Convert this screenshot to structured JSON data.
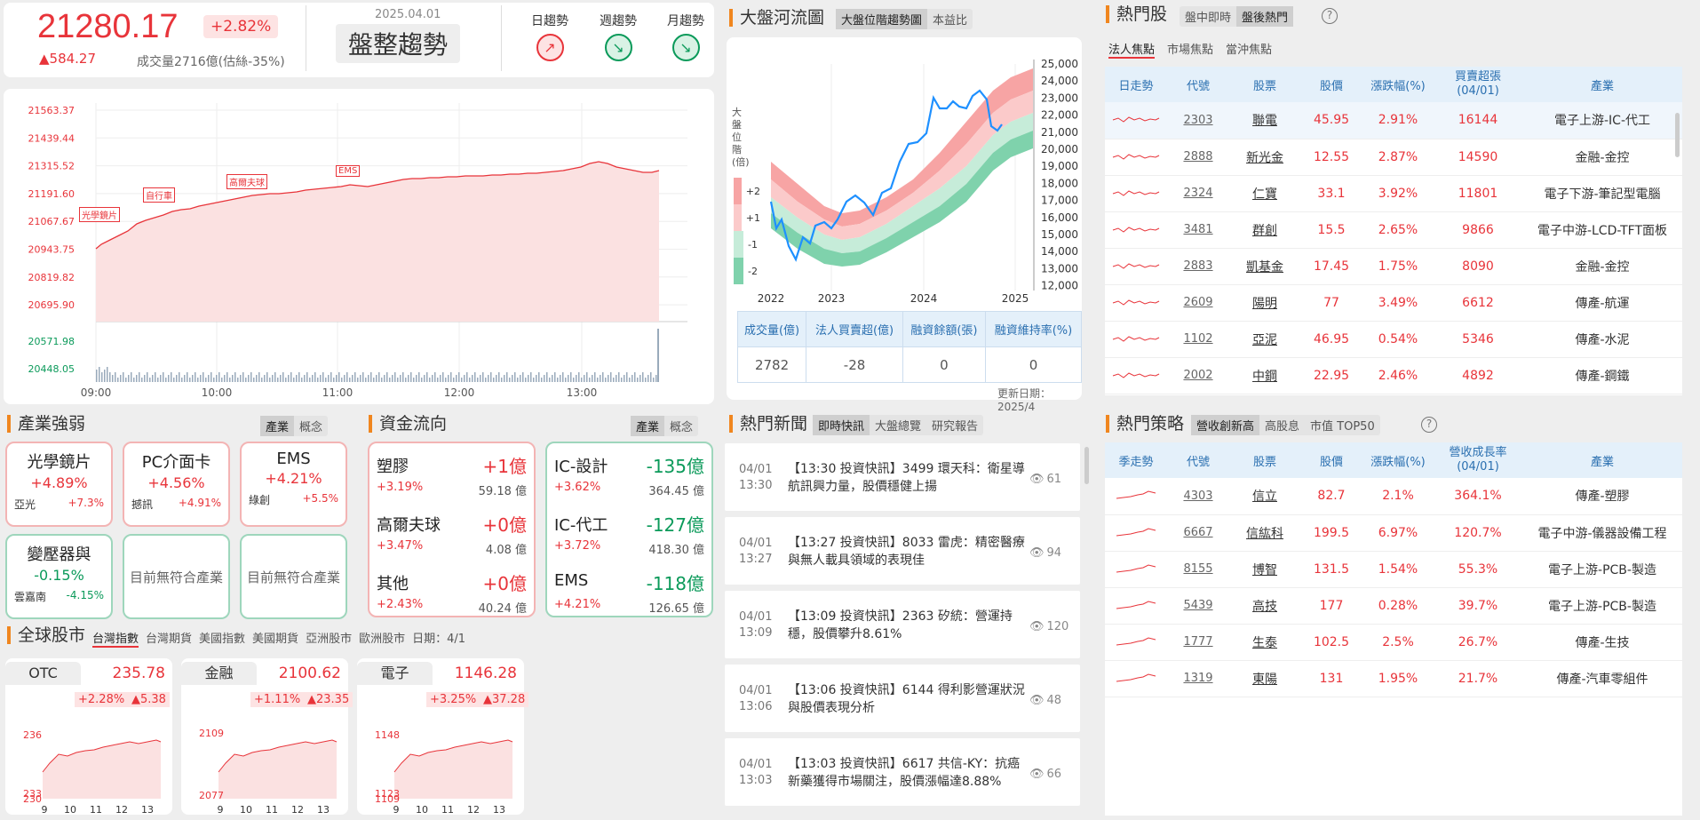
{
  "colors": {
    "up": "#e8343a",
    "down": "#0b9a5a",
    "accent": "#f0861f",
    "header_bg": "#e4f0fa"
  },
  "index": {
    "value": "21280.17",
    "pct": "+2.82%",
    "change": "▲584.27",
    "volume": "成交量2716億(估絲-35%)",
    "date": "2025.04.01",
    "trend": "盤整趨勢"
  },
  "trends": [
    {
      "label": "日趨勢",
      "dir": "up",
      "icon": "trend-up-icon"
    },
    {
      "label": "週趨勢",
      "dir": "down",
      "icon": "trend-down-icon"
    },
    {
      "label": "月趨勢",
      "dir": "down",
      "icon": "trend-down-icon"
    }
  ],
  "intraday": {
    "y_ticks": [
      "21563.37",
      "21439.44",
      "21315.52",
      "21191.60",
      "21067.67",
      "20943.75",
      "20819.82",
      "20695.90"
    ],
    "vol_ticks": [
      "20571.98",
      "20448.05"
    ],
    "x_ticks": [
      "09:00",
      "10:00",
      "11:00",
      "12:00",
      "13:00"
    ],
    "annotations": [
      "光學鏡片",
      "自行車",
      "高爾夫球",
      "EMS"
    ]
  },
  "river": {
    "title": "大盤河流圖",
    "tabs": [
      "大盤位階趨勢圖",
      "本益比"
    ],
    "y_ticks": [
      "25,000",
      "24,000",
      "23,000",
      "22,000",
      "21,000",
      "20,000",
      "19,000",
      "18,000",
      "17,000",
      "16,000",
      "15,000",
      "14,000",
      "13,000",
      "12,000"
    ],
    "x_ticks": [
      "2022",
      "2023",
      "2024",
      "2025"
    ],
    "side_label": "大盤位階(倍)",
    "legend": [
      "+2",
      "+1",
      "-1",
      "-2"
    ],
    "stats_headers": [
      "成交量(億)",
      "法人買賣超(億)",
      "融資餘額(張)",
      "融資維持率(%)"
    ],
    "stats_values": [
      "2782",
      "-28",
      "0",
      "0"
    ],
    "updated": "更新日期：2025/4"
  },
  "chart_data": {
    "type": "line",
    "title": "",
    "x": [
      "2022",
      "2023",
      "2024",
      "2025"
    ],
    "xlabel": "",
    "ylabel": "大盤位階(倍)",
    "ylim": [
      12000,
      25000
    ]
  },
  "hot": {
    "title": "熱門股",
    "tabs": [
      "盤中即時",
      "盤後熱門"
    ],
    "subtabs": [
      "法人焦點",
      "市場焦點",
      "當沖焦點"
    ],
    "headers": [
      "日走勢",
      "代號",
      "股票",
      "股價",
      "漲跌幅(%)",
      "買賣超張\n(04/01)",
      "產業"
    ],
    "rows": [
      [
        "2303",
        "聯電",
        "45.95",
        "2.91%",
        "16144",
        "電子上游-IC-代工"
      ],
      [
        "2888",
        "新光金",
        "12.55",
        "2.87%",
        "14590",
        "金融-金控"
      ],
      [
        "2324",
        "仁寶",
        "33.1",
        "3.92%",
        "11801",
        "電子下游-筆記型電腦"
      ],
      [
        "3481",
        "群創",
        "15.5",
        "2.65%",
        "9866",
        "電子中游-LCD-TFT面板"
      ],
      [
        "2883",
        "凱基金",
        "17.45",
        "1.75%",
        "8090",
        "金融-金控"
      ],
      [
        "2609",
        "陽明",
        "77",
        "3.49%",
        "6612",
        "傳產-航運"
      ],
      [
        "1102",
        "亞泥",
        "46.95",
        "0.54%",
        "5346",
        "傳產-水泥"
      ],
      [
        "2002",
        "中鋼",
        "22.95",
        "2.46%",
        "4892",
        "傳產-鋼鐵"
      ]
    ]
  },
  "sectors": {
    "title": "產業強弱",
    "tabs": [
      "產業",
      "概念"
    ],
    "boxes": [
      {
        "name": "光學鏡片",
        "pct": "+4.89%",
        "stock": "亞光",
        "spct": "+7.3%",
        "dir": "up"
      },
      {
        "name": "PC介面卡",
        "pct": "+4.56%",
        "stock": "撼訊",
        "spct": "+4.91%",
        "dir": "up"
      },
      {
        "name": "EMS",
        "pct": "+4.21%",
        "stock": "綠創",
        "spct": "+5.5%",
        "dir": "up"
      },
      {
        "name": "變壓器與",
        "pct": "-0.15%",
        "stock": "雲嘉南",
        "spct": "-4.15%",
        "dir": "down"
      },
      {
        "name": "目前無符合產業",
        "pct": "",
        "stock": "",
        "spct": "",
        "dir": "none"
      },
      {
        "name": "目前無符合產業",
        "pct": "",
        "stock": "",
        "spct": "",
        "dir": "none"
      }
    ]
  },
  "funds": {
    "title": "資金流向",
    "tabs": [
      "產業",
      "概念"
    ],
    "inflow": [
      {
        "name": "塑膠",
        "amt": "+1億",
        "pct": "+3.19%",
        "total": "59.18 億"
      },
      {
        "name": "高爾夫球",
        "amt": "+0億",
        "pct": "+3.47%",
        "total": "4.08 億"
      },
      {
        "name": "其他",
        "amt": "+0億",
        "pct": "+2.43%",
        "total": "40.24 億"
      }
    ],
    "outflow": [
      {
        "name": "IC-設計",
        "amt": "-135億",
        "pct": "+3.62%",
        "total": "364.45 億"
      },
      {
        "name": "IC-代工",
        "amt": "-127億",
        "pct": "+3.72%",
        "total": "418.30 億"
      },
      {
        "name": "EMS",
        "amt": "-118億",
        "pct": "+4.21%",
        "total": "126.65 億"
      }
    ]
  },
  "global": {
    "title": "全球股市",
    "tabs": [
      "台灣指數",
      "台灣期貨",
      "美國指數",
      "美國期貨",
      "亞洲股市",
      "歐洲股市"
    ],
    "date": "日期：4/1",
    "cards": [
      {
        "name": "OTC",
        "value": "235.78",
        "pct": "+2.28%",
        "chg": "▲5.38",
        "ticks": [
          "236",
          "233",
          "230"
        ],
        "x": [
          "9",
          "10",
          "11",
          "12",
          "13"
        ]
      },
      {
        "name": "金融",
        "value": "2100.62",
        "pct": "+1.11%",
        "chg": "▲23.35",
        "ticks": [
          "2109",
          "2077"
        ],
        "x": [
          "9",
          "10",
          "11",
          "12",
          "13"
        ]
      },
      {
        "name": "電子",
        "value": "1146.28",
        "pct": "+3.25%",
        "chg": "▲37.28",
        "ticks": [
          "1148",
          "1123",
          "1109"
        ],
        "x": [
          "9",
          "10",
          "11",
          "12",
          "13"
        ]
      }
    ]
  },
  "news": {
    "title": "熱門新聞",
    "tabs": [
      "即時快訊",
      "大盤總覽",
      "研究報告"
    ],
    "items": [
      {
        "date": "04/01",
        "time": "13:30",
        "text": "【13:30 投資快訊】3499 環天科：衛星導航訊興力量，股價穩健上揚",
        "views": "61"
      },
      {
        "date": "04/01",
        "time": "13:27",
        "text": "【13:27 投資快訊】8033 雷虎：精密醫療與無人載具領域的表現佳",
        "views": "94"
      },
      {
        "date": "04/01",
        "time": "13:09",
        "text": "【13:09 投資快訊】2363 矽統：營運持穩，股價攀升8.61%",
        "views": "120"
      },
      {
        "date": "04/01",
        "time": "13:06",
        "text": "【13:06 投資快訊】6144 得利影營運狀況與股價表現分析",
        "views": "48"
      },
      {
        "date": "04/01",
        "time": "13:03",
        "text": "【13:03 投資快訊】6617 共信-KY：抗癌新藥獲得市場關注，股價漲幅達8.88%",
        "views": "66"
      }
    ]
  },
  "strategy": {
    "title": "熱門策略",
    "tabs": [
      "營收創新高",
      "高股息",
      "市值 TOP50"
    ],
    "headers": [
      "季走勢",
      "代號",
      "股票",
      "股價",
      "漲跌幅(%)",
      "營收成長率\n(04/01)",
      "產業"
    ],
    "rows": [
      [
        "4303",
        "信立",
        "82.7",
        "2.1%",
        "364.1%",
        "傳產-塑膠"
      ],
      [
        "6667",
        "信紘科",
        "199.5",
        "6.97%",
        "120.7%",
        "電子中游-儀器設備工程"
      ],
      [
        "8155",
        "博智",
        "131.5",
        "1.54%",
        "55.3%",
        "電子上游-PCB-製造"
      ],
      [
        "5439",
        "高技",
        "177",
        "0.28%",
        "39.7%",
        "電子上游-PCB-製造"
      ],
      [
        "1777",
        "生泰",
        "102.5",
        "2.5%",
        "26.7%",
        "傳產-生技"
      ],
      [
        "1319",
        "東陽",
        "131",
        "1.95%",
        "21.7%",
        "傳產-汽車零組件"
      ]
    ]
  }
}
